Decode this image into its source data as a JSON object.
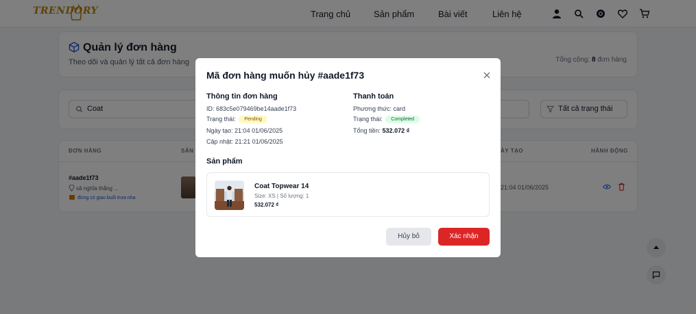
{
  "header": {
    "logo": "TRENDORY",
    "nav": [
      "Trang chủ",
      "Sản phẩm",
      "Bài viết",
      "Liên hệ"
    ],
    "icons": [
      "user-icon",
      "search-icon",
      "chatgpt-icon",
      "heart-icon",
      "cart-icon"
    ]
  },
  "page": {
    "title": "Quản lý đơn hàng",
    "subtitle": "Theo dõi và quản lý tất cả đơn hàng",
    "total_label": "Tổng cộng:",
    "total_count": "8",
    "total_unit": "đơn hàng",
    "search_value": "Coat",
    "status_filter": "Tất cả trạng thái"
  },
  "table": {
    "headers": [
      "ĐƠN HÀNG",
      "SẢN PH",
      "ÀY TẠO",
      "HÀNH ĐỘNG"
    ],
    "row": {
      "id": "#aade1f73",
      "address": "xã nghĩa thắng ...",
      "note": "đừng có giao buổi trưa nha",
      "date": "21:04 01/06/2025"
    }
  },
  "modal": {
    "title": "Mã đơn hàng muốn hủy #aade1f73",
    "order_info_title": "Thông tin đơn hàng",
    "id_label": "ID:",
    "id_value": "683c5e079469be14aade1f73",
    "status_label": "Trạng thái:",
    "status_value": "Pending",
    "created_label": "Ngày tạo:",
    "created_value": "21:04 01/06/2025",
    "updated_label": "Cập nhật:",
    "updated_value": "21:21 01/06/2025",
    "payment_title": "Thanh toán",
    "method_label": "Phương thức:",
    "method_value": "card",
    "pay_status_label": "Trạng thái:",
    "pay_status_value": "Completed",
    "total_label": "Tổng tiền:",
    "total_value": "532.072 ₫",
    "products_title": "Sản phẩm",
    "product": {
      "name": "Coat Topwear 14",
      "meta": "Size: XS | Số lượng: 1",
      "price": "532.072 ₫"
    },
    "cancel_label": "Hủy bỏ",
    "confirm_label": "Xác nhận"
  },
  "colors": {
    "confirm": "#dc2626",
    "pending_badge": "#fef9c3",
    "completed_badge": "#dcfce7",
    "brand": "#b8860b"
  }
}
